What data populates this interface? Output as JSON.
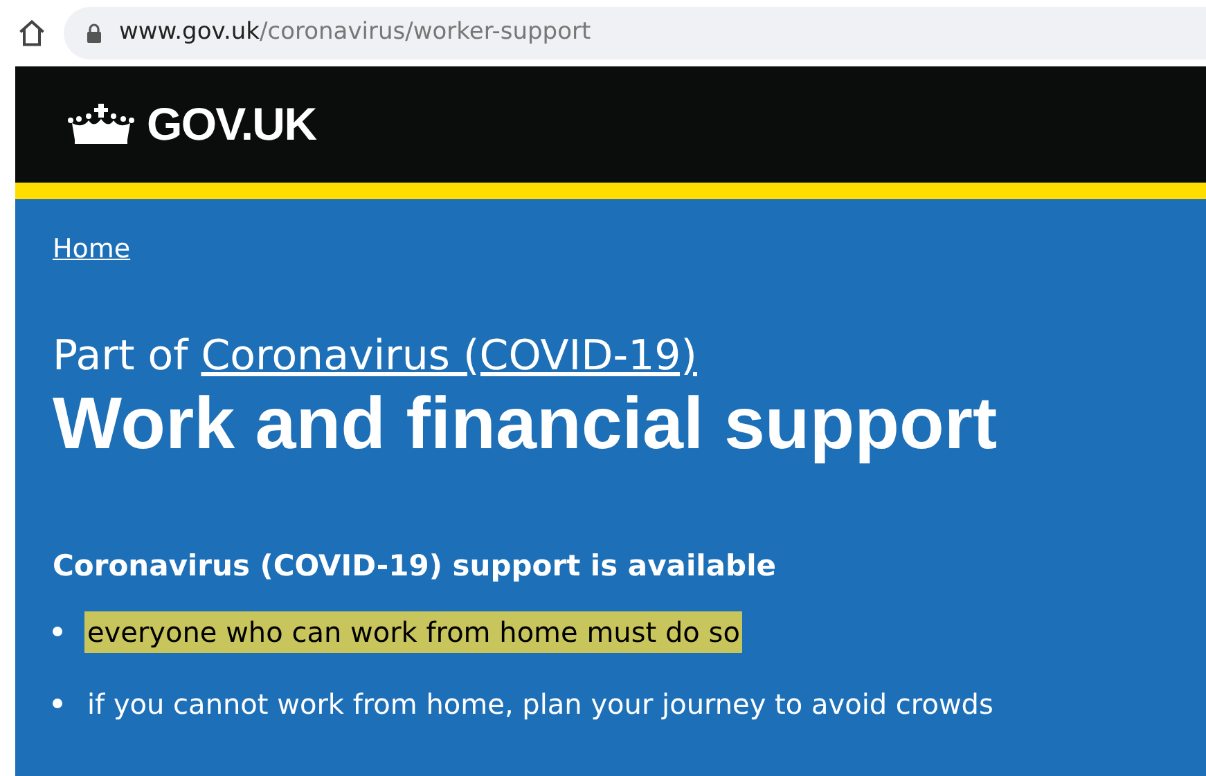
{
  "address_bar": {
    "host": "www.gov.uk",
    "path": "/coronavirus/worker-support"
  },
  "header": {
    "logo_text": "GOV.UK"
  },
  "breadcrumb": {
    "label": "Home"
  },
  "title": {
    "prefix": "Part of ",
    "link": "Coronavirus (COVID-19)",
    "heading": "Work and financial support"
  },
  "section": {
    "heading": "Coronavirus (COVID-19) support is available",
    "items": [
      {
        "text": "everyone who can work from home must do so",
        "highlighted": true
      },
      {
        "text": "if you cannot work from home, plan your journey to avoid crowds",
        "highlighted": false
      }
    ]
  }
}
